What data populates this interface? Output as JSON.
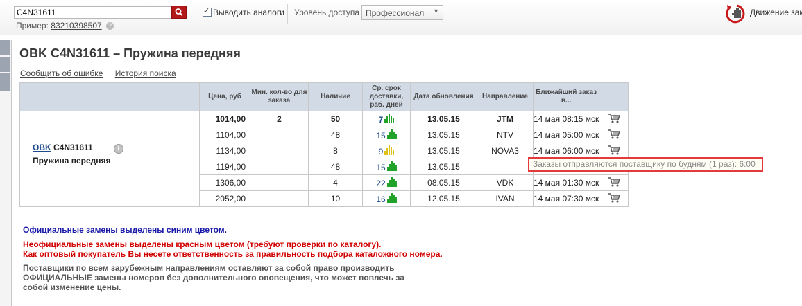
{
  "search": {
    "value": "C4N31611",
    "example_label": "Пример:",
    "example_value": "83210398507",
    "help": "?"
  },
  "analogs": {
    "label": "Выводить аналоги",
    "checked": true
  },
  "access": {
    "label": "Уровень доступа",
    "value": "Профессионал"
  },
  "movement": {
    "label": "Движение зак"
  },
  "part": {
    "title": "OBK C4N31611 – Пружина передняя",
    "brand": "OBK",
    "number": "C4N31611",
    "info": "i",
    "name": "Пружина передняя"
  },
  "links": {
    "report": "Сообщить об ошибке",
    "history": "История поиска"
  },
  "table": {
    "headers": [
      "Цена, руб",
      "Мин. кол-во для заказа",
      "Наличие",
      "Ср. срок доставки, раб. дней",
      "Дата обновления",
      "Направление",
      "Ближайший заказ в..."
    ],
    "rows": [
      {
        "price": "1014,00",
        "min": "2",
        "stock": "50",
        "days": "7",
        "rating": "high",
        "date": "13.05.15",
        "dir": "JTM",
        "next": "14 мая 08:15 мск"
      },
      {
        "price": "1104,00",
        "min": "",
        "stock": "48",
        "days": "15",
        "rating": "high",
        "date": "13.05.15",
        "dir": "NTV",
        "next": "14 мая 05:00 мск"
      },
      {
        "price": "1134,00",
        "min": "",
        "stock": "8",
        "days": "9",
        "rating": "mid",
        "date": "13.05.15",
        "dir": "NOVA3",
        "next": "14 мая 06:00 мск"
      },
      {
        "price": "1194,00",
        "min": "",
        "stock": "48",
        "days": "15",
        "rating": "high",
        "date": "13.05.15",
        "dir": "",
        "next": ""
      },
      {
        "price": "1306,00",
        "min": "",
        "stock": "4",
        "days": "22",
        "rating": "high",
        "date": "08.05.15",
        "dir": "VDK",
        "next": "14 мая 01:30 мск"
      },
      {
        "price": "2052,00",
        "min": "",
        "stock": "10",
        "days": "16",
        "rating": "high",
        "date": "12.05.15",
        "dir": "IVAN",
        "next": "14 мая 07:30 мск"
      }
    ]
  },
  "tooltip": "Заказы отправляются поставщику по будням (1 раз): 6:00",
  "notes": {
    "blue": "Официальные замены выделены синим цветом.",
    "red1": "Неофициальные замены выделены красным цветом (требуют проверки по каталогу).",
    "red2": "Как оптовый покупатель Вы несете ответственность за правильность подбора каталожного номера.",
    "gray1": "Поставщики по всем зарубежным направлениям оставляют за собой право производить",
    "gray2": "ОФИЦИАЛЬНЫЕ замены номеров без дополнительного оповещения, что может повлечь за",
    "gray3": "собой изменение цены."
  },
  "colors": {
    "accent_red": "#b21a1a",
    "header_bg": "#d2dae5",
    "official": "#1a1aa8",
    "unofficial": "#d10000",
    "bar_green": "#21a32a",
    "bar_yellow": "#e0c21a"
  }
}
